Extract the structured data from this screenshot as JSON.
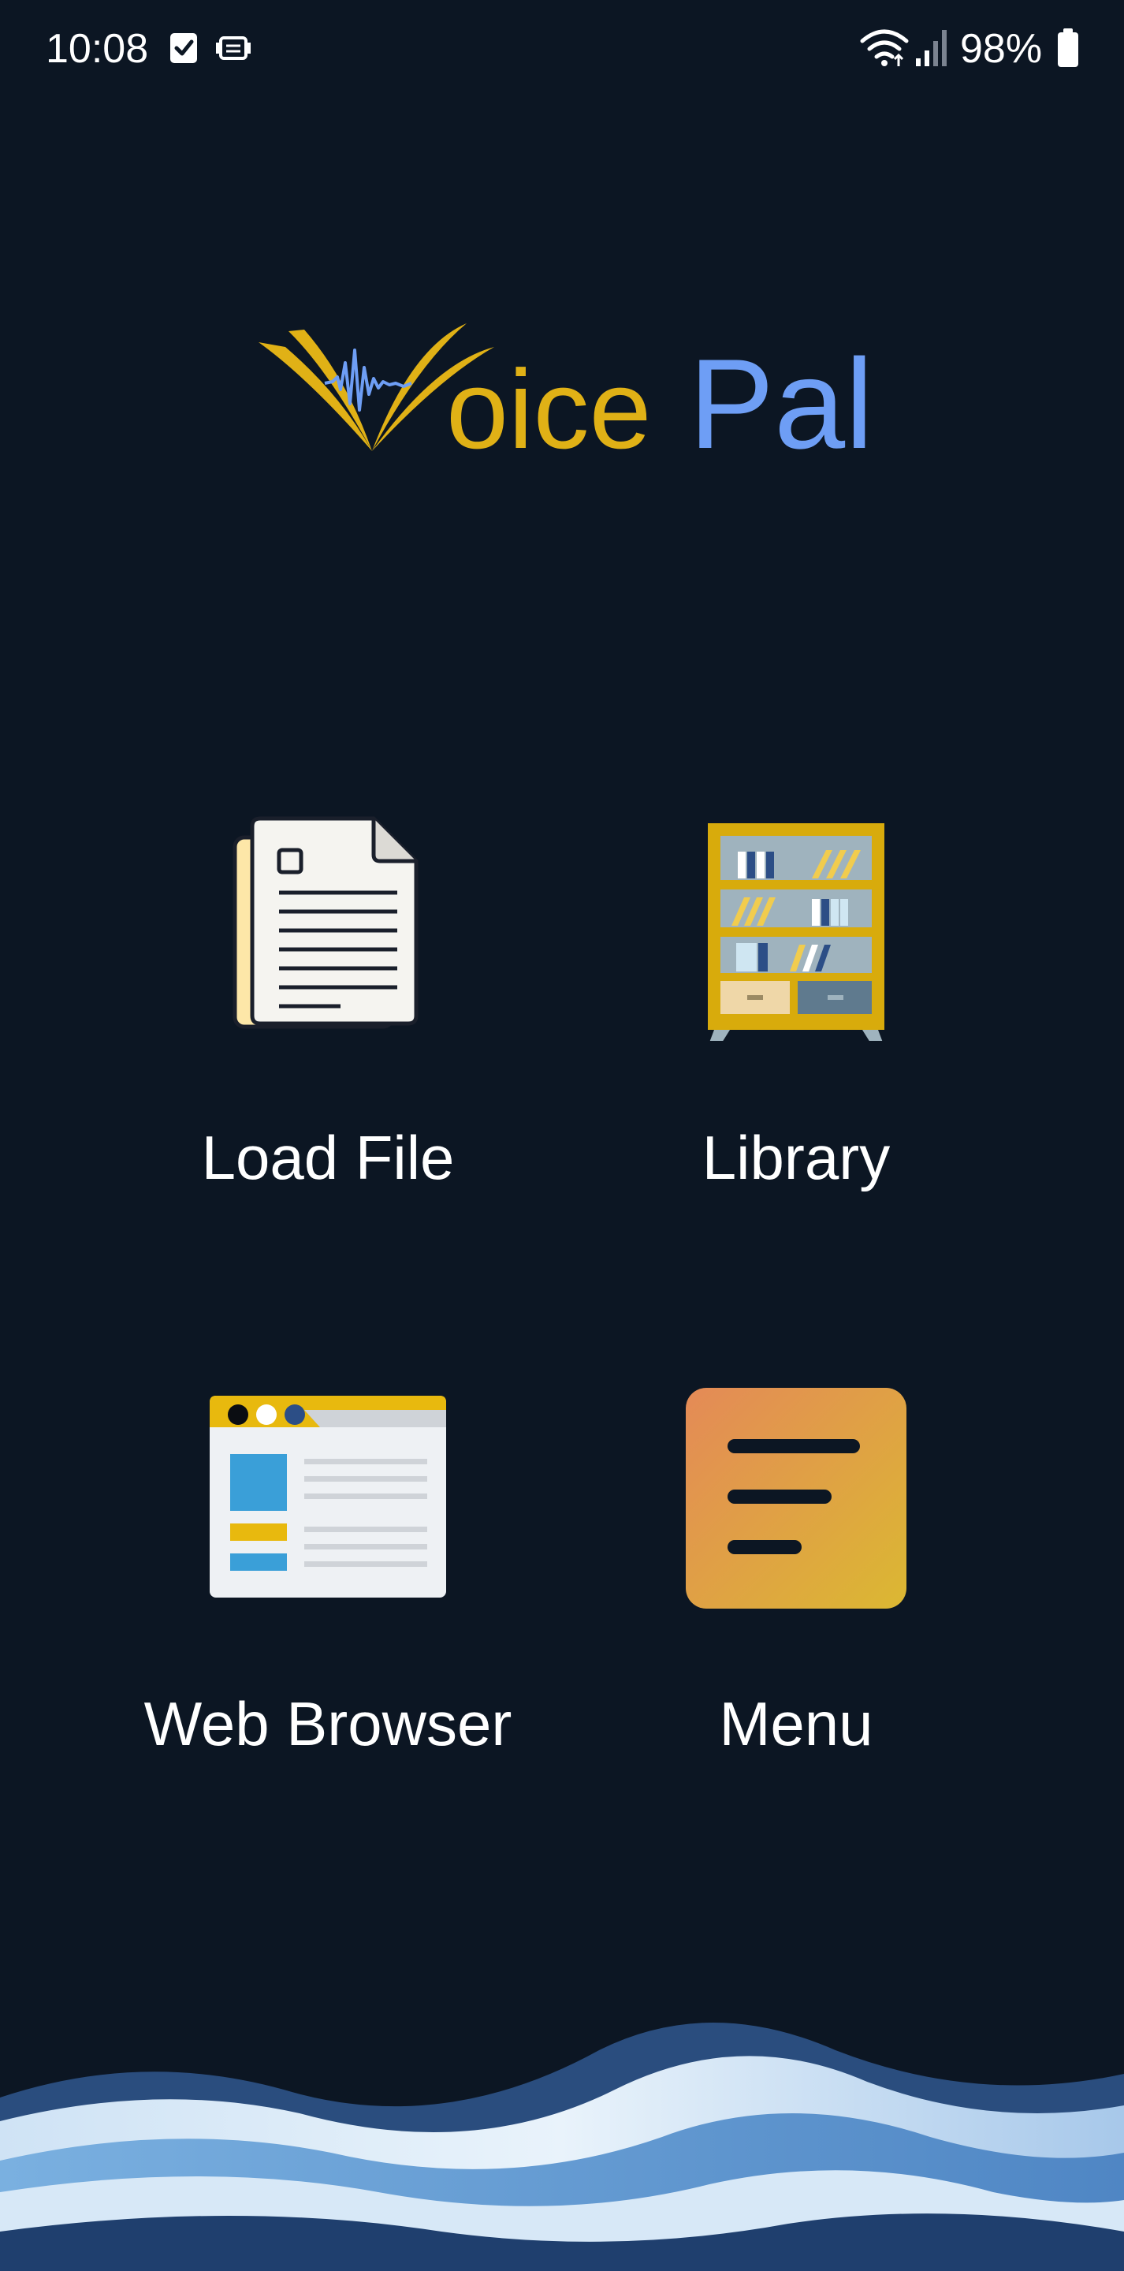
{
  "status_bar": {
    "time": "10:08",
    "battery_percent": "98%",
    "icons": [
      "checkbox-notification-icon",
      "screen-record-icon",
      "wifi-icon",
      "signal-icon",
      "battery-icon"
    ]
  },
  "app": {
    "logo_text_part1": "oice",
    "logo_text_part2": "Pal",
    "colors": {
      "background": "#0c1623",
      "brand_gold": "#e0b116",
      "brand_blue": "#6e9ef5"
    }
  },
  "tiles": [
    {
      "label": "Load File",
      "icon": "document-icon"
    },
    {
      "label": "Library",
      "icon": "bookshelf-icon"
    },
    {
      "label": "Web Browser",
      "icon": "browser-window-icon"
    },
    {
      "label": "Menu",
      "icon": "menu-icon"
    }
  ]
}
